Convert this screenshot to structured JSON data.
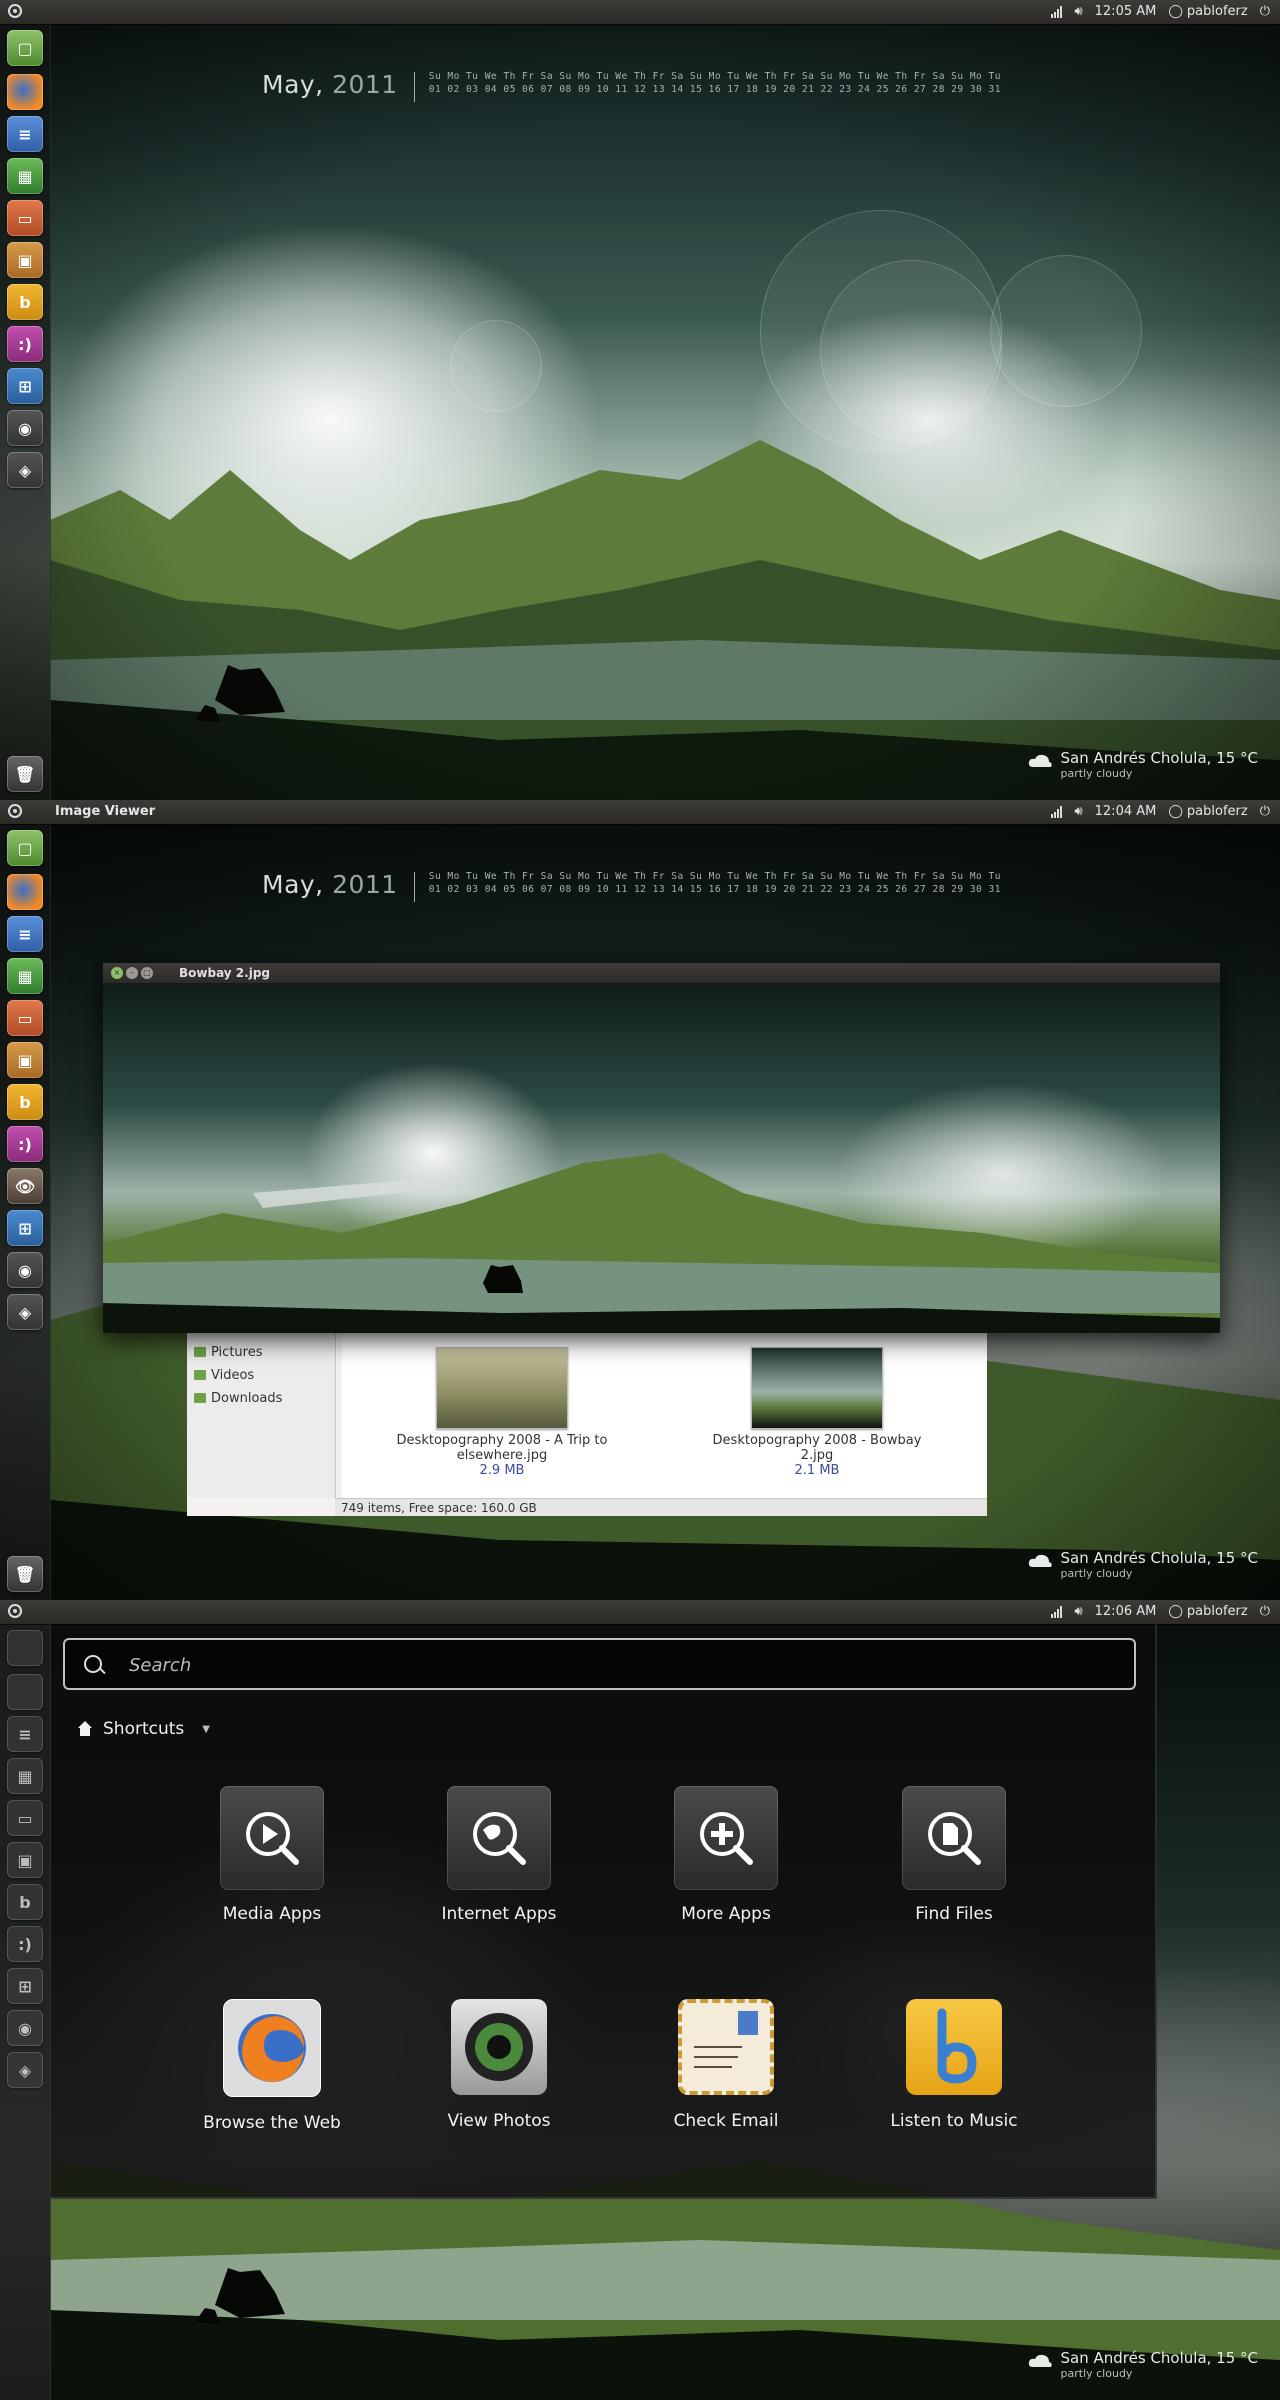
{
  "panels": [
    {
      "app_title": "",
      "time": "12:05 AM",
      "user": "pabloferz"
    },
    {
      "app_title": "Image Viewer",
      "time": "12:04 AM",
      "user": "pabloferz"
    },
    {
      "app_title": "",
      "time": "12:06 AM",
      "user": "pabloferz"
    }
  ],
  "calendar": {
    "month": "May,",
    "year": "2011",
    "weekdays": "Su Mo Tu We Th Fr Sa Su Mo Tu We Th Fr Sa Su Mo Tu We Th Fr Sa Su Mo Tu We Th Fr Sa Su Mo Tu",
    "days": "01 02 03 04 05 06 07 08 09 10 11 12 13 14 15 16 17 18 19 20 21 22 23 24 25 26 27 28 29 30 31",
    "today": "04"
  },
  "weather": {
    "city": "San Andrés Cholula, 15 °C",
    "condition": "partly cloudy"
  },
  "viewer": {
    "title": "Bowbay 2.jpg"
  },
  "filemanager": {
    "places": [
      "Pictures",
      "Videos",
      "Downloads"
    ],
    "files": [
      {
        "name": "Desktopography 2008 - A Trip to elsewhere.jpg",
        "size": "2.9 MB"
      },
      {
        "name": "Desktopography 2008 - Bowbay 2.jpg",
        "size": "2.1 MB"
      }
    ],
    "status": "749 items, Free space: 160.0 GB"
  },
  "dash": {
    "search_placeholder": "Search",
    "section": "Shortcuts",
    "lenses": [
      "Media Apps",
      "Internet Apps",
      "More Apps",
      "Find Files"
    ],
    "apps": [
      "Browse the Web",
      "View Photos",
      "Check Email",
      "Listen to Music"
    ]
  },
  "colors": {
    "panel": "#3c3b37",
    "accent_orange": "#dd4814",
    "file_size": "#3a4ca0"
  }
}
